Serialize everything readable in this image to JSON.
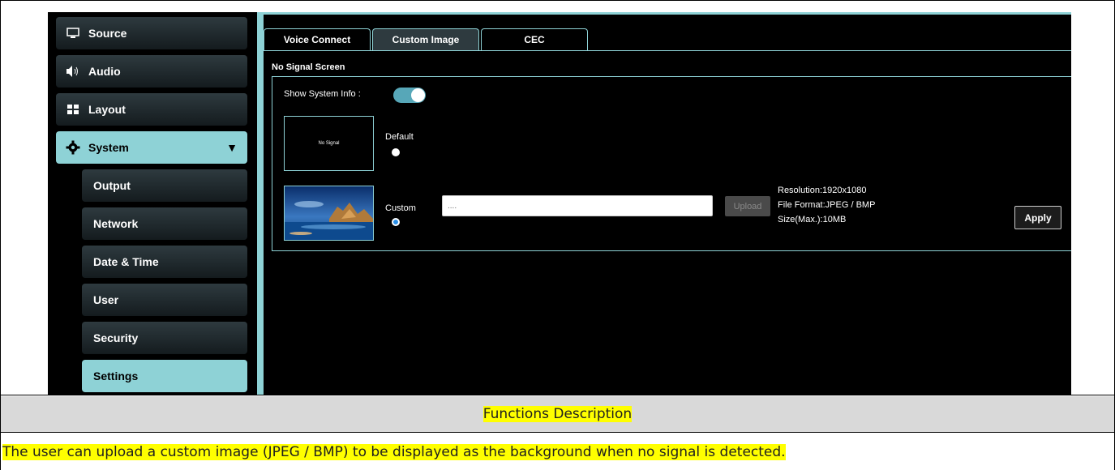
{
  "sidebar": {
    "items": [
      {
        "label": "Source",
        "icon": "monitor-icon"
      },
      {
        "label": "Audio",
        "icon": "speaker-icon"
      },
      {
        "label": "Layout",
        "icon": "layout-icon"
      },
      {
        "label": "System",
        "icon": "gear-icon"
      }
    ],
    "subitems": [
      {
        "label": "Output"
      },
      {
        "label": "Network"
      },
      {
        "label": "Date & Time"
      },
      {
        "label": "User"
      },
      {
        "label": "Security"
      },
      {
        "label": "Settings"
      }
    ]
  },
  "tabs": [
    {
      "label": "Voice Connect"
    },
    {
      "label": "Custom Image"
    },
    {
      "label": "CEC"
    }
  ],
  "main": {
    "section_title": "No Signal Screen",
    "show_system_info_label": "Show System Info :",
    "show_system_info_enabled": true,
    "default_thumb_text": "No Signal",
    "default_label": "Default",
    "custom_label": "Custom",
    "path_value": "....",
    "upload_label": "Upload",
    "resolution": "Resolution:1920x1080",
    "file_format": "File Format:JPEG / BMP",
    "size": "Size(Max.):10MB",
    "apply_label": "Apply"
  },
  "doc": {
    "description_header": "Functions Description",
    "description_text": "The user can upload a custom image (JPEG / BMP) to be displayed as the background when no signal is detected."
  },
  "colors": {
    "accent": "#8ed2d6",
    "toggle": "#57a7b8",
    "radio_selected": "#2a8fe8",
    "highlight": "#ffff00",
    "header_bg": "#d9d9d9"
  }
}
